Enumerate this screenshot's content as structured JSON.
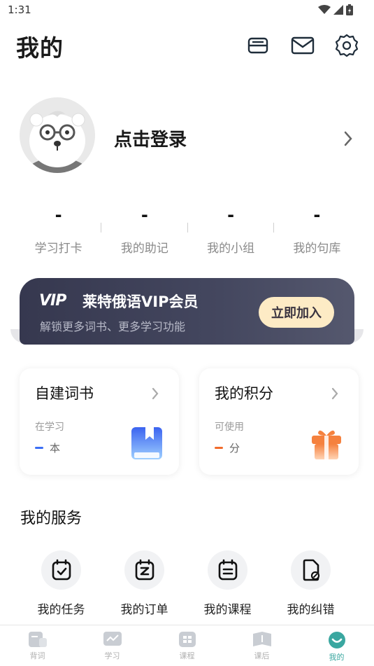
{
  "status_bar": {
    "time": "1:31"
  },
  "header": {
    "title": "我的",
    "icons": [
      "wallet-icon",
      "mail-icon",
      "settings-icon"
    ]
  },
  "profile": {
    "login_text": "点击登录"
  },
  "stats": [
    {
      "value": "-",
      "label": "学习打卡"
    },
    {
      "value": "-",
      "label": "我的助记"
    },
    {
      "value": "-",
      "label": "我的小组"
    },
    {
      "value": "-",
      "label": "我的句库"
    }
  ],
  "vip": {
    "logo": "VIP",
    "title": "莱特俄语VIP会员",
    "subtitle": "解锁更多词书、更多学习功能",
    "button": "立即加入"
  },
  "cards": {
    "wordbook": {
      "title": "自建词书",
      "sub": "在学习",
      "value": "-",
      "unit": "本",
      "accent": "#3b6ef5"
    },
    "points": {
      "title": "我的积分",
      "sub": "可使用",
      "value": "-",
      "unit": "分",
      "accent": "#f26b2b"
    }
  },
  "services_section": {
    "title": "我的服务",
    "items": [
      {
        "label": "我的任务",
        "icon": "task-icon"
      },
      {
        "label": "我的订单",
        "icon": "order-icon"
      },
      {
        "label": "我的课程",
        "icon": "course-icon"
      },
      {
        "label": "我的纠错",
        "icon": "correction-icon"
      }
    ]
  },
  "tabs": [
    {
      "label": "背词",
      "icon": "vocab-icon"
    },
    {
      "label": "学习",
      "icon": "study-icon"
    },
    {
      "label": "课程",
      "icon": "course-tab-icon"
    },
    {
      "label": "课后",
      "icon": "after-class-icon"
    },
    {
      "label": "我的",
      "icon": "me-icon",
      "active": true
    }
  ],
  "colors": {
    "accent": "#3aa7a0",
    "vip_bg": "#3c3f57",
    "vip_button": "#fdebc5"
  }
}
